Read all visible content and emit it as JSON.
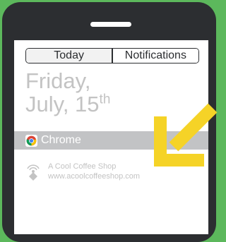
{
  "tabs": [
    {
      "label": "Today",
      "active": true
    },
    {
      "label": "Notifications",
      "active": false
    }
  ],
  "date": {
    "line1": "Friday,",
    "line2": "July, 15",
    "suffix": "th"
  },
  "highlight_row": {
    "app_name": "Chrome",
    "icon": "chrome-logo-icon"
  },
  "notification": {
    "title": "A Cool Coffee Shop",
    "url": "www.acoolcoffeeshop.com",
    "icon": "location-beacon-icon"
  },
  "colors": {
    "background": "#5cb85c",
    "phone": "#2c2e31",
    "highlight": "#c2c3c5",
    "muted_text": "#c3c3c3",
    "arrow": "#f5d327"
  }
}
